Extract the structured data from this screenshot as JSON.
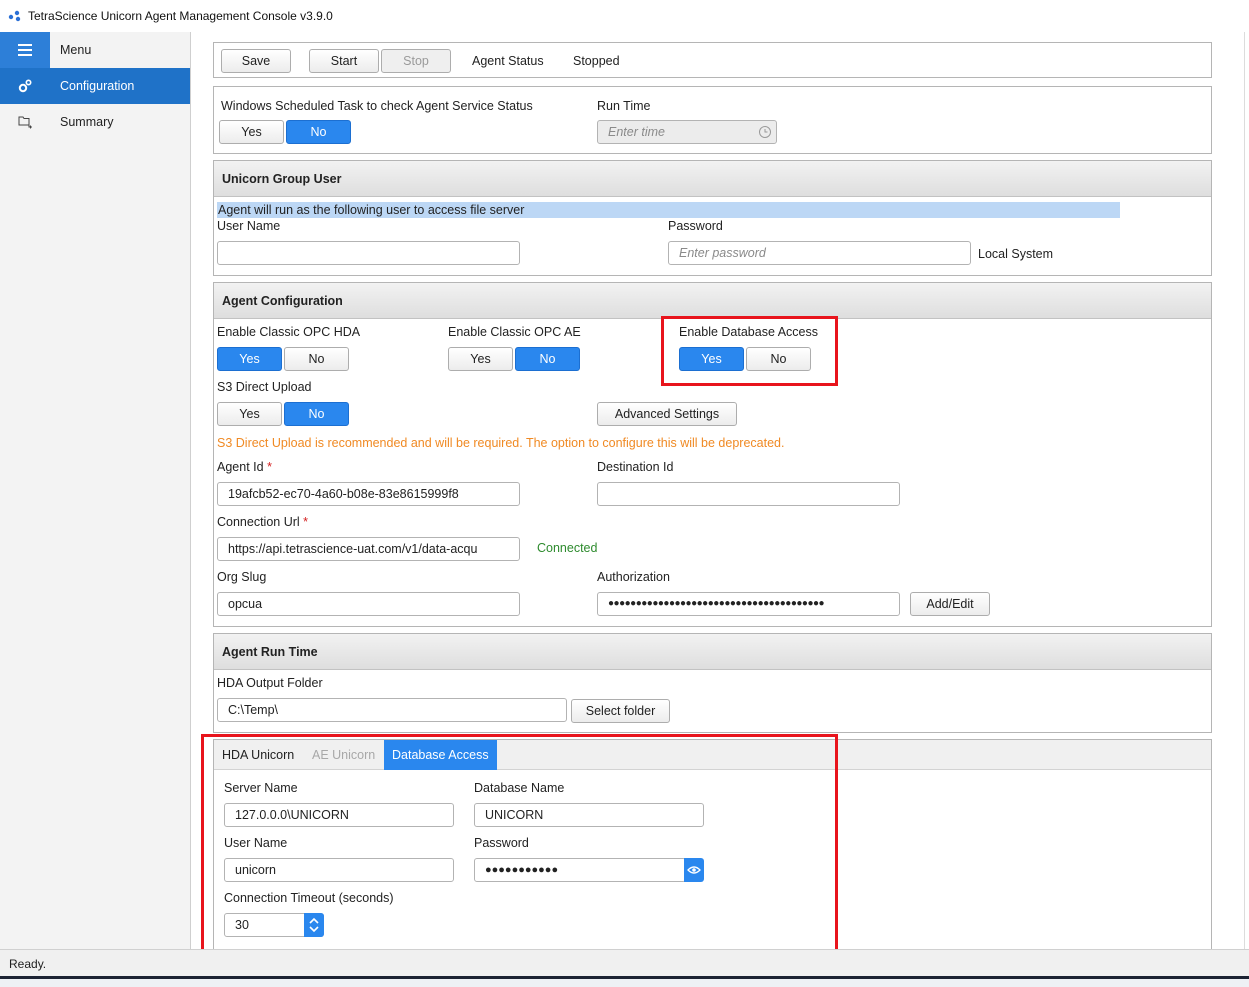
{
  "window": {
    "title": "TetraScience Unicorn Agent Management Console v3.9.0"
  },
  "sidebar": {
    "menu_label": "Menu",
    "items": [
      {
        "label": "Configuration",
        "icon": "gears-icon",
        "active": true
      },
      {
        "label": "Summary",
        "icon": "folder-tree-icon",
        "active": false
      }
    ]
  },
  "toolbar": {
    "save_label": "Save",
    "start_label": "Start",
    "stop_label": "Stop",
    "agent_status_label": "Agent Status",
    "agent_status_value": "Stopped"
  },
  "scheduled_task": {
    "label": "Windows Scheduled Task to check Agent Service Status",
    "yes": "Yes",
    "no": "No",
    "selected": "No",
    "run_time_label": "Run Time",
    "run_time_placeholder": "Enter time"
  },
  "group_user": {
    "header": "Unicorn Group User",
    "info": "Agent will run as the following user to access file server",
    "username_label": "User Name",
    "username_value": "",
    "password_label": "Password",
    "password_placeholder": "Enter password",
    "local_system_label": "Local System"
  },
  "agent_config": {
    "header": "Agent Configuration",
    "opc_hda_label": "Enable Classic OPC HDA",
    "opc_hda_selected": "Yes",
    "opc_ae_label": "Enable Classic OPC AE",
    "opc_ae_selected": "No",
    "db_access_label": "Enable Database Access",
    "db_access_selected": "Yes",
    "s3_label": "S3 Direct Upload",
    "s3_selected": "No",
    "yes": "Yes",
    "no": "No",
    "advanced_settings_label": "Advanced Settings",
    "s3_warning": "S3 Direct Upload is recommended and will be required. The option to configure this will be deprecated.",
    "agent_id_label": "Agent Id",
    "agent_id_value": "19afcb52-ec70-4a60-b08e-83e8615999f8",
    "destination_id_label": "Destination Id",
    "destination_id_value": "",
    "connection_url_label": "Connection Url",
    "connection_url_value": "https://api.tetrascience-uat.com/v1/data-acqu",
    "connected_label": "Connected",
    "org_slug_label": "Org Slug",
    "org_slug_value": "opcua",
    "authorization_label": "Authorization",
    "authorization_value": "●●●●●●●●●●●●●●●●●●●●●●●●●●●●●●●●●●●●●●●",
    "add_edit_label": "Add/Edit",
    "required_mark": "*"
  },
  "run_time": {
    "header": "Agent Run Time",
    "hda_folder_label": "HDA Output Folder",
    "hda_folder_value": "C:\\Temp\\",
    "select_folder_label": "Select folder"
  },
  "tabs": {
    "items": [
      "HDA Unicorn",
      "AE Unicorn",
      "Database Access"
    ],
    "active": "Database Access"
  },
  "database": {
    "server_name_label": "Server Name",
    "server_name_value": "127.0.0.0\\UNICORN",
    "database_name_label": "Database Name",
    "database_name_value": "UNICORN",
    "user_name_label": "User Name",
    "user_name_value": "unicorn",
    "password_label": "Password",
    "password_value": "●●●●●●●●●●●",
    "timeout_label": "Connection Timeout (seconds)",
    "timeout_value": "30"
  },
  "status": {
    "text": "Ready."
  },
  "colors": {
    "accent": "#2a87ee",
    "highlight_box": "#e8141c",
    "warning": "#f08a24",
    "connected": "#2e8b2e"
  }
}
